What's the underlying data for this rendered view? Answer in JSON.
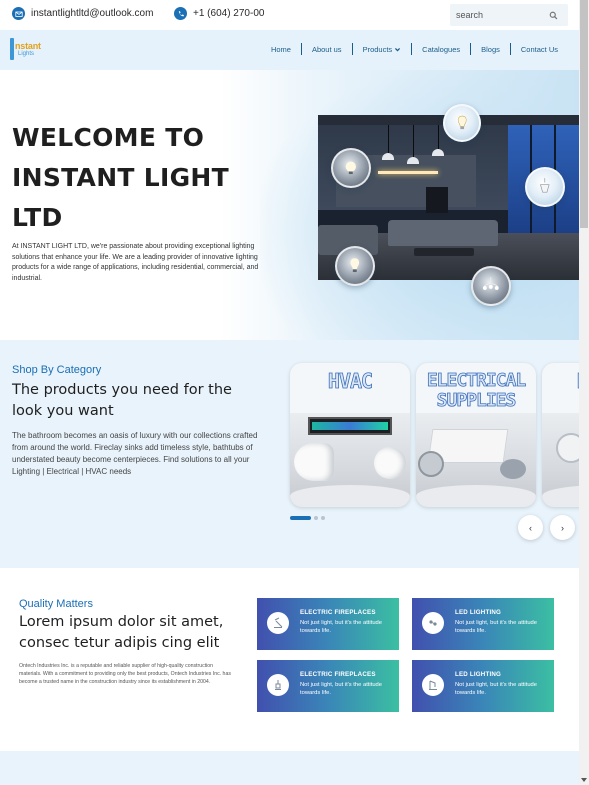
{
  "contact": {
    "email": "instantlightltd@outlook.com",
    "phone": "+1 (604) 270-00"
  },
  "search": {
    "placeholder": "search"
  },
  "logo": {
    "word": "nstant",
    "word2": "Lights"
  },
  "nav": {
    "items": [
      "Home",
      "About us",
      "Products",
      "Catalogues",
      "Blogs",
      "Contact Us"
    ]
  },
  "hero": {
    "title": "WELCOME TO INSTANT LIGHT LTD",
    "text": "At INSTANT LIGHT LTD, we're passionate about providing exceptional lighting solutions that enhance your life. We are a leading provider of innovative lighting products for a wide range of applications, including residential, commercial, and industrial."
  },
  "shop": {
    "kicker": "Shop By Category",
    "heading": "The products you need for the look you want",
    "text": "The bathroom becomes an oasis of luxury with our collections crafted from around the world. Fireclay sinks add timeless style, bathtubs of understated beauty become centerpieces. Find solutions to all your Lighting | Electrical | HVAC needs",
    "cards": [
      {
        "title": "HVAC"
      },
      {
        "title": "ELECTRICAL SUPPLIES"
      },
      {
        "title": "L"
      }
    ],
    "prev": "‹",
    "next": "›"
  },
  "quality": {
    "kicker": "Quality Matters",
    "heading": "Lorem ipsum dolor sit amet, consec tetur adipis cing elit",
    "text": "Ontech Industries Inc. is a reputable and reliable supplier of high-quality construction materials. With a commitment to providing only the best products, Ontech Industries Inc. has become a trusted name in the construction industry since its establishment in 2004.",
    "features": [
      {
        "title": "ELECTRIC FIREPLACES",
        "subtitle": "Not just light, but it's the attitude towards life."
      },
      {
        "title": "LED LIGHTING",
        "subtitle": "Not just light, but it's the attitude towards life."
      },
      {
        "title": "ELECTRIC FIREPLACES",
        "subtitle": "Not just light, but it's the attitude towards life."
      },
      {
        "title": "LED LIGHTING",
        "subtitle": "Not just light, but it's the attitude towards life."
      }
    ]
  },
  "colors": {
    "accent": "#1a6fb5",
    "nav_text": "#1b5d8a",
    "feature_gradient_start": "#4150ae",
    "feature_gradient_end": "#3bbfa2",
    "section_bg": "#e8f3fb"
  },
  "icons": {
    "email": "envelope-icon",
    "phone": "phone-icon",
    "search": "magnifier-icon",
    "dropdown": "chevron-down-icon",
    "feature": "lamp-icon"
  }
}
